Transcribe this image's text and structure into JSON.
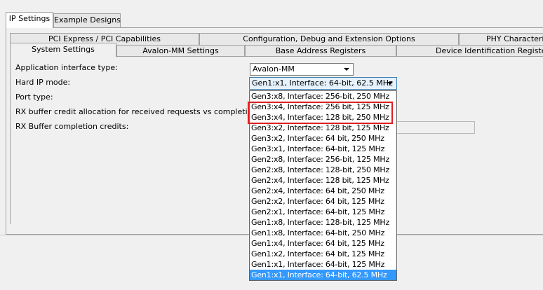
{
  "outer_tabs": [
    {
      "label": "IP Settings",
      "active": true
    },
    {
      "label": "Example Designs",
      "active": false
    }
  ],
  "tabs_row1": [
    {
      "label": "PCI Express / PCI Capabilities"
    },
    {
      "label": "Configuration, Debug and Extension Options"
    },
    {
      "label": "PHY Characteristics"
    }
  ],
  "tabs_row2": [
    {
      "label": "System Settings",
      "active": true
    },
    {
      "label": "Avalon-MM Settings"
    },
    {
      "label": "Base Address Registers"
    },
    {
      "label": "Device Identification Registers"
    }
  ],
  "fields": {
    "app_interface_label": "Application interface type:",
    "app_interface_value": "Avalon-MM",
    "hard_ip_label": "Hard IP mode:",
    "hard_ip_value": "Gen1:x1, Interface: 64-bit, 62.5 MHz",
    "port_type_label": "Port type:",
    "rx_credit_label": "RX buffer credit allocation for received requests vs completions:",
    "rx_completion_label": "RX Buffer completion credits:"
  },
  "dropdown_items": [
    "Gen3:x8, Interface: 256-bit, 250 MHz",
    "Gen3:x4, Interface: 256 bit, 125 MHz",
    "Gen3:x4, Interface: 128 bit, 250 MHz",
    "Gen3:x2, Interface: 128 bit, 125 MHz",
    "Gen3:x2, Interface: 64 bit, 250 MHz",
    "Gen3:x1, Interface: 64-bit, 125 MHz",
    "Gen2:x8, Interface: 256-bit, 125 MHz",
    "Gen2:x8, Interface: 128-bit, 250 MHz",
    "Gen2:x4, Interface: 128 bit, 125 MHz",
    "Gen2:x4, Interface: 64 bit, 250 MHz",
    "Gen2:x2, Interface: 64 bit, 125 MHz",
    "Gen2:x1, Interface: 64-bit, 125 MHz",
    "Gen1:x8, Interface: 128-bit, 125 MHz",
    "Gen1:x8, Interface: 64-bit, 250 MHz",
    "Gen1:x4, Interface: 64 bit, 125 MHz",
    "Gen1:x2, Interface: 64 bit, 125 MHz",
    "Gen1:x1, Interface: 64-bit, 125 MHz",
    "Gen1:x1, Interface: 64-bit, 62.5 MHz"
  ],
  "selected_index": 17,
  "highlight_color": "#e02020",
  "selection_color": "#3399ff"
}
